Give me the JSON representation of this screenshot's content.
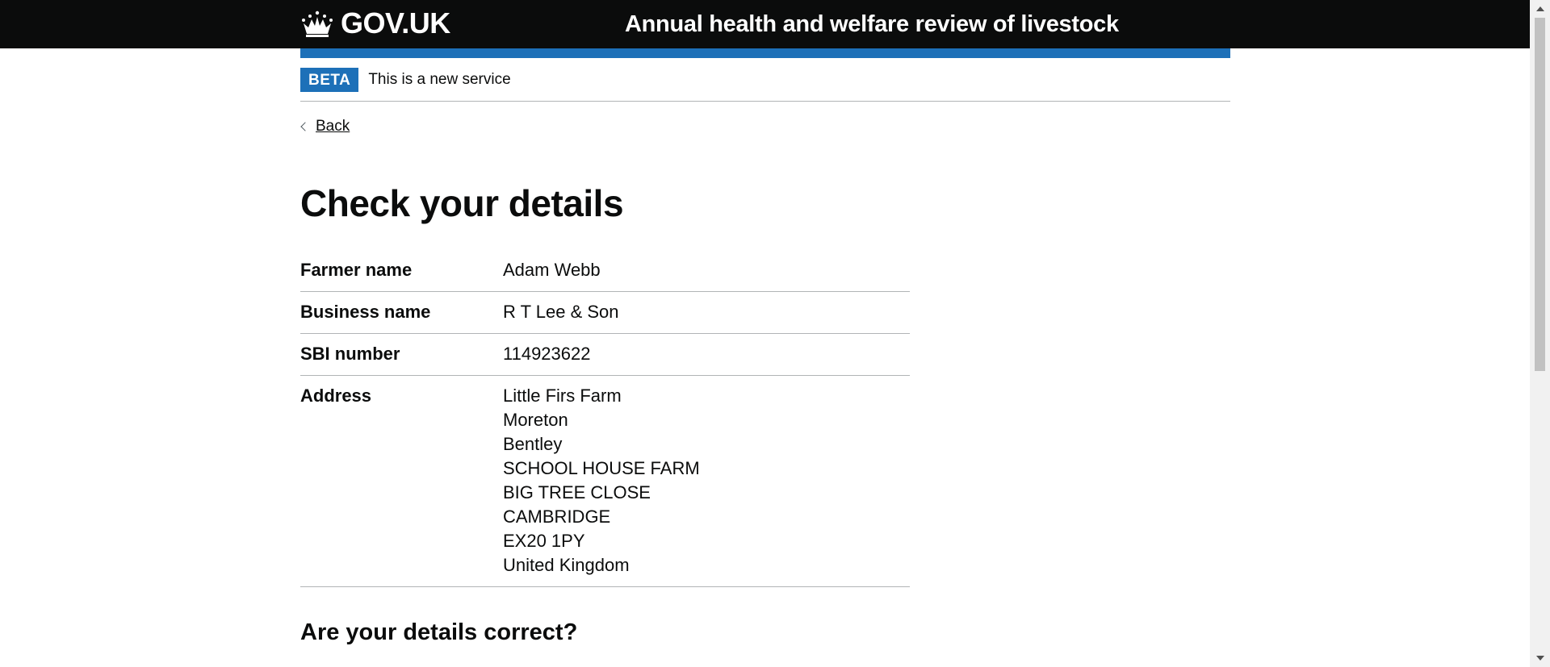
{
  "header": {
    "logo_text": "GOV.UK",
    "service_name": "Annual health and welfare review of livestock"
  },
  "phase_banner": {
    "tag": "BETA",
    "text": "This is a new service"
  },
  "back_link": "Back",
  "page_title": "Check your details",
  "summary": {
    "rows": [
      {
        "key": "Farmer name",
        "value": "Adam Webb"
      },
      {
        "key": "Business name",
        "value": "R T Lee & Son"
      },
      {
        "key": "SBI number",
        "value": "114923622"
      }
    ],
    "address": {
      "key": "Address",
      "lines": [
        "Little Firs Farm",
        "Moreton",
        "Bentley",
        "SCHOOL HOUSE FARM",
        "BIG TREE CLOSE",
        "CAMBRIDGE",
        "EX20 1PY",
        "United Kingdom"
      ]
    }
  },
  "question": "Are your details correct?",
  "colors": {
    "header_bg": "#0b0c0c",
    "brand_blue": "#1d70b8",
    "border": "#b1b4b6"
  }
}
